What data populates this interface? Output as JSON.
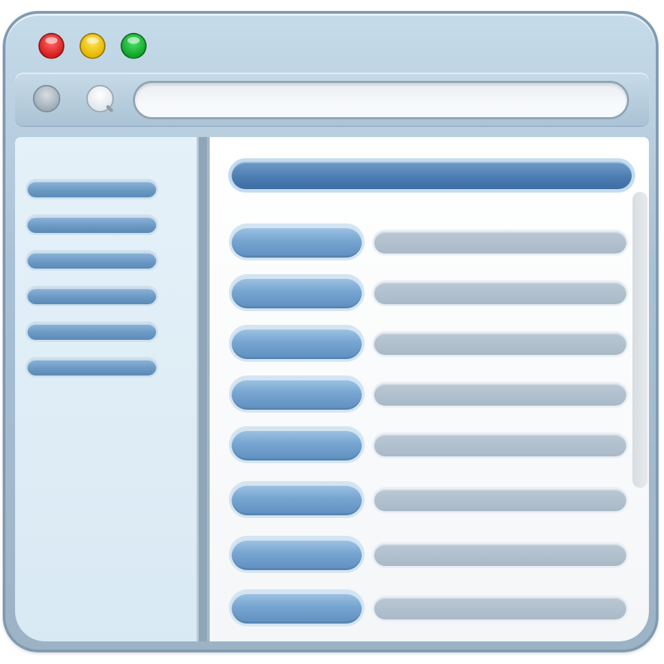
{
  "window": {
    "title_bar": {
      "controls": [
        {
          "name": "close",
          "color": "#e53935"
        },
        {
          "name": "minimize",
          "color": "#f5c518"
        },
        {
          "name": "maximize",
          "color": "#22b43f"
        }
      ]
    },
    "toolbar": {
      "back_icon": "circle-button-icon",
      "search_icon": "magnifier-icon",
      "address": {
        "value": "",
        "placeholder": ""
      }
    }
  },
  "sidebar": {
    "items": [
      {
        "label": ""
      },
      {
        "label": ""
      },
      {
        "label": ""
      },
      {
        "label": ""
      },
      {
        "label": ""
      },
      {
        "label": ""
      }
    ]
  },
  "main": {
    "header": {
      "label": ""
    },
    "rows": [
      {
        "button": "",
        "value": ""
      },
      {
        "button": "",
        "value": ""
      },
      {
        "button": "",
        "value": ""
      },
      {
        "button": "",
        "value": ""
      },
      {
        "button": "",
        "value": ""
      },
      {
        "button": "",
        "value": ""
      },
      {
        "button": "",
        "value": ""
      },
      {
        "button": "",
        "value": ""
      }
    ]
  },
  "colors": {
    "frame": "#a9c1d4",
    "accent": "#4a7bb0",
    "sidebar_bg": "#e2eff8",
    "row_button": "#78a6d2",
    "row_field": "#aebdcb"
  }
}
